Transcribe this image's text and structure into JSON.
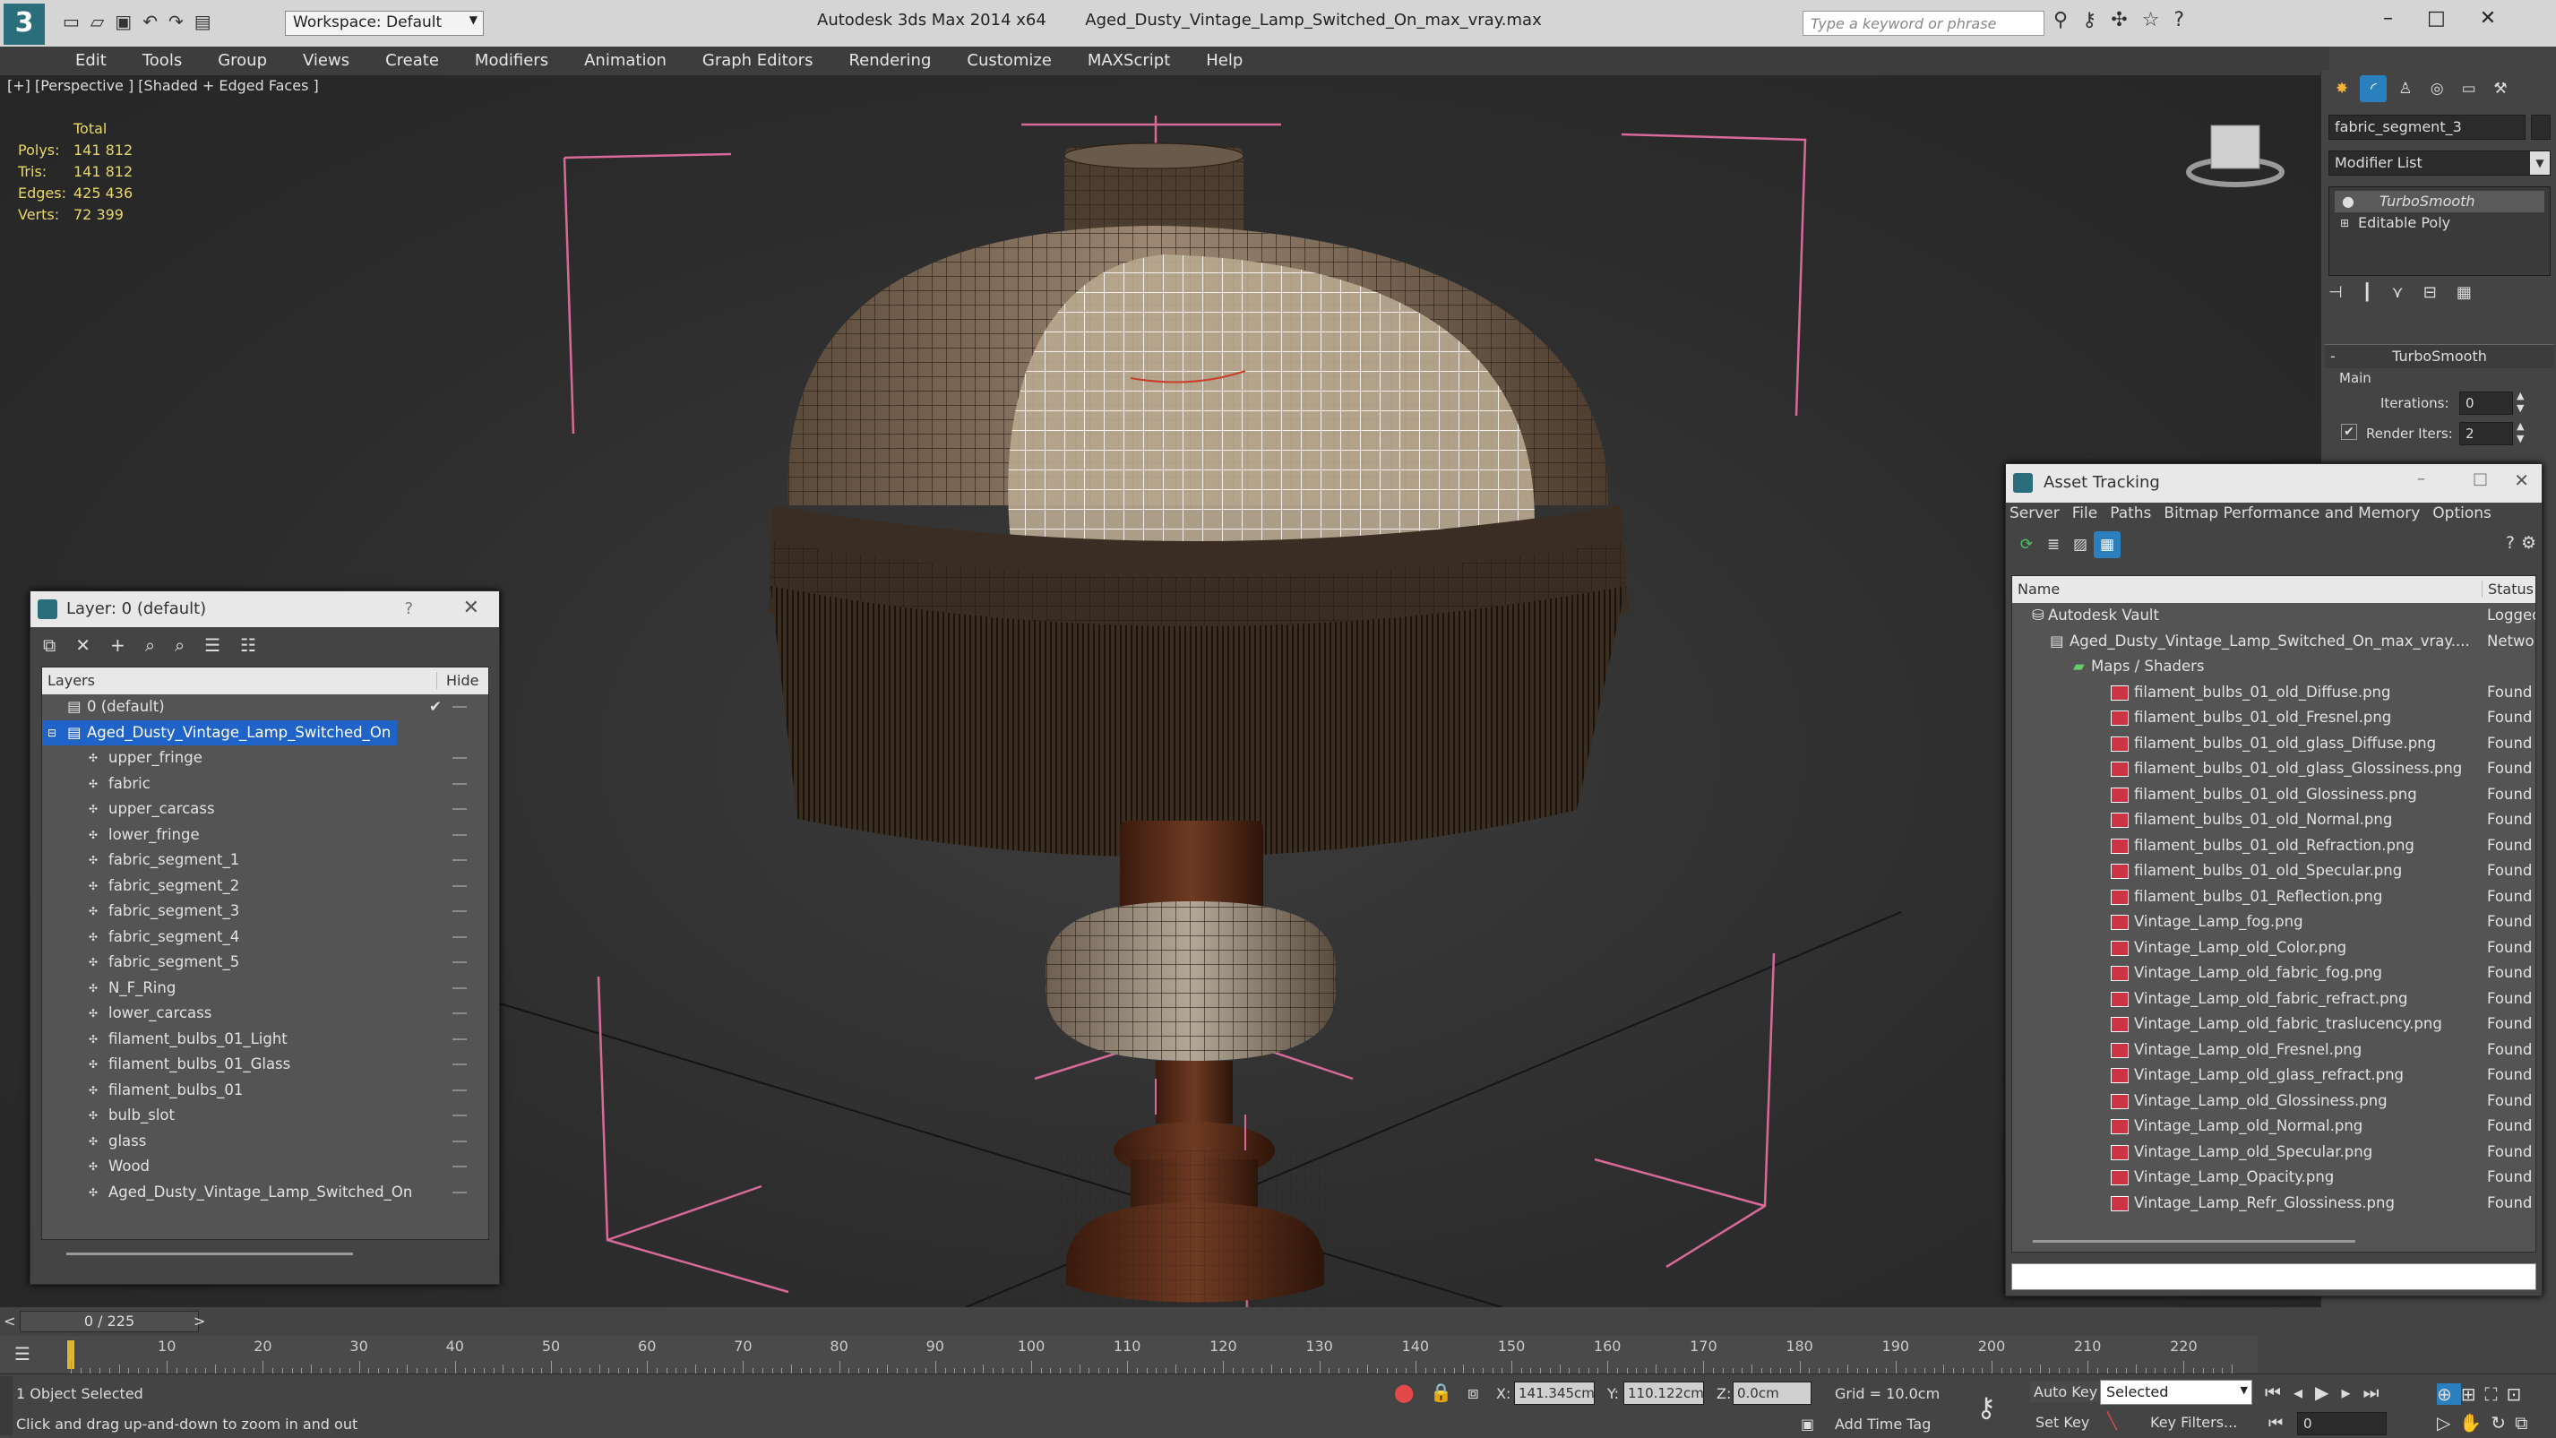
{
  "titlebar": {
    "app": "Autodesk 3ds Max  2014 x64",
    "file": "Aged_Dusty_Vintage_Lamp_Switched_On_max_vray.max",
    "workspace_label": "Workspace: Default",
    "search_placeholder": "Type a keyword or phrase"
  },
  "menu": [
    "Edit",
    "Tools",
    "Group",
    "Views",
    "Create",
    "Modifiers",
    "Animation",
    "Graph Editors",
    "Rendering",
    "Customize",
    "MAXScript",
    "Help"
  ],
  "viewport": {
    "label": "[+] [Perspective ] [Shaded + Edged Faces ]",
    "stats_header": "Total",
    "stats": [
      {
        "k": "Polys:",
        "v": "141 812"
      },
      {
        "k": "Tris:",
        "v": "141 812"
      },
      {
        "k": "Edges:",
        "v": "425 436"
      },
      {
        "k": "Verts:",
        "v": "72 399"
      }
    ]
  },
  "cmdpanel": {
    "object_name": "fabric_segment_3",
    "modifier_list": "Modifier List",
    "stack": [
      "TurboSmooth",
      "Editable Poly"
    ],
    "rollout_title": "TurboSmooth",
    "group_main": "Main",
    "iterations_label": "Iterations:",
    "iterations_value": "0",
    "render_iters_label": "Render Iters:",
    "render_iters_value": "2"
  },
  "layer_dialog": {
    "title": "Layer: 0 (default)",
    "col_layers": "Layers",
    "col_hide": "Hide",
    "help": "?",
    "default_layer": "0 (default)",
    "selected_layer": "Aged_Dusty_Vintage_Lamp_Switched_On",
    "children": [
      "upper_fringe",
      "fabric",
      "upper_carcass",
      "lower_fringe",
      "fabric_segment_1",
      "fabric_segment_2",
      "fabric_segment_3",
      "fabric_segment_4",
      "fabric_segment_5",
      "N_F_Ring",
      "lower_carcass",
      "filament_bulbs_01_Light",
      "filament_bulbs_01_Glass",
      "filament_bulbs_01",
      "bulb_slot",
      "glass",
      "Wood",
      "Aged_Dusty_Vintage_Lamp_Switched_On"
    ]
  },
  "asset_dialog": {
    "title": "Asset Tracking",
    "menu": [
      "Server",
      "File",
      "Paths",
      "Bitmap Performance and Memory",
      "Options"
    ],
    "col_name": "Name",
    "col_status": "Status",
    "vault": {
      "name": "Autodesk Vault",
      "status": "Logged"
    },
    "maxfile": {
      "name": "Aged_Dusty_Vintage_Lamp_Switched_On_max_vray....",
      "status": "Networ"
    },
    "maps_folder": "Maps / Shaders",
    "files": [
      {
        "name": "filament_bulbs_01_old_Diffuse.png",
        "status": "Found"
      },
      {
        "name": "filament_bulbs_01_old_Fresnel.png",
        "status": "Found"
      },
      {
        "name": "filament_bulbs_01_old_glass_Diffuse.png",
        "status": "Found"
      },
      {
        "name": "filament_bulbs_01_old_glass_Glossiness.png",
        "status": "Found"
      },
      {
        "name": "filament_bulbs_01_old_Glossiness.png",
        "status": "Found"
      },
      {
        "name": "filament_bulbs_01_old_Normal.png",
        "status": "Found"
      },
      {
        "name": "filament_bulbs_01_old_Refraction.png",
        "status": "Found"
      },
      {
        "name": "filament_bulbs_01_old_Specular.png",
        "status": "Found"
      },
      {
        "name": "filament_bulbs_01_Reflection.png",
        "status": "Found"
      },
      {
        "name": "Vintage_Lamp_fog.png",
        "status": "Found"
      },
      {
        "name": "Vintage_Lamp_old_Color.png",
        "status": "Found"
      },
      {
        "name": "Vintage_Lamp_old_fabric_fog.png",
        "status": "Found"
      },
      {
        "name": "Vintage_Lamp_old_fabric_refract.png",
        "status": "Found"
      },
      {
        "name": "Vintage_Lamp_old_fabric_traslucency.png",
        "status": "Found"
      },
      {
        "name": "Vintage_Lamp_old_Fresnel.png",
        "status": "Found"
      },
      {
        "name": "Vintage_Lamp_old_glass_refract.png",
        "status": "Found"
      },
      {
        "name": "Vintage_Lamp_old_Glossiness.png",
        "status": "Found"
      },
      {
        "name": "Vintage_Lamp_old_Normal.png",
        "status": "Found"
      },
      {
        "name": "Vintage_Lamp_old_Specular.png",
        "status": "Found"
      },
      {
        "name": "Vintage_Lamp_Opacity.png",
        "status": "Found"
      },
      {
        "name": "Vintage_Lamp_Refr_Glossiness.png",
        "status": "Found"
      }
    ]
  },
  "timeline": {
    "frame_counter": "0 / 225",
    "ticks": [
      "10",
      "20",
      "30",
      "40",
      "50",
      "60",
      "70",
      "80",
      "90",
      "100",
      "110",
      "120",
      "130",
      "140",
      "150",
      "160",
      "170",
      "180",
      "190",
      "200",
      "210",
      "220"
    ]
  },
  "status": {
    "selection": "1 Object Selected",
    "prompt": "Click and drag up-and-down to zoom in and out",
    "x_label": "X:",
    "x_value": "141.345cm",
    "y_label": "Y:",
    "y_value": "110.122cm",
    "z_label": "Z:",
    "z_value": "0.0cm",
    "grid": "Grid = 10.0cm",
    "add_time_tag": "Add Time Tag",
    "auto_key": "Auto Key",
    "set_key": "Set Key",
    "key_mode": "Selected",
    "key_filters": "Key Filters...",
    "current_frame": "0"
  },
  "colors": {
    "accent": "#1c7ed6",
    "selection": "#2f5fb3",
    "gizmo": "#d86a9a",
    "found": "#e2e2e2"
  }
}
